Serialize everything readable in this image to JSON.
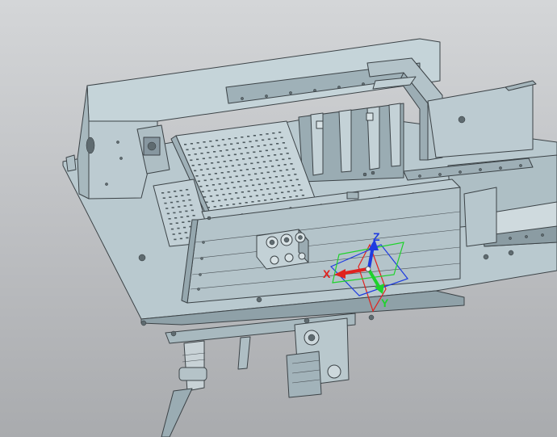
{
  "viewport": {
    "background_top": "#d4d6d8",
    "background_bottom": "#a9abae",
    "part_color": "#b7c7cd",
    "part_shadow_color": "#8ea0a7",
    "edge_color": "#3c4347"
  },
  "triad": {
    "x_label": "X",
    "y_label": "Y",
    "z_label": "Z",
    "x_color": "#e0231f",
    "y_color": "#1fd22c",
    "z_color": "#1f3ce0",
    "plane_xy_color": "#1f3ce0",
    "plane_yz_color": "#e0231f",
    "plane_xz_color": "#1fd22c"
  }
}
